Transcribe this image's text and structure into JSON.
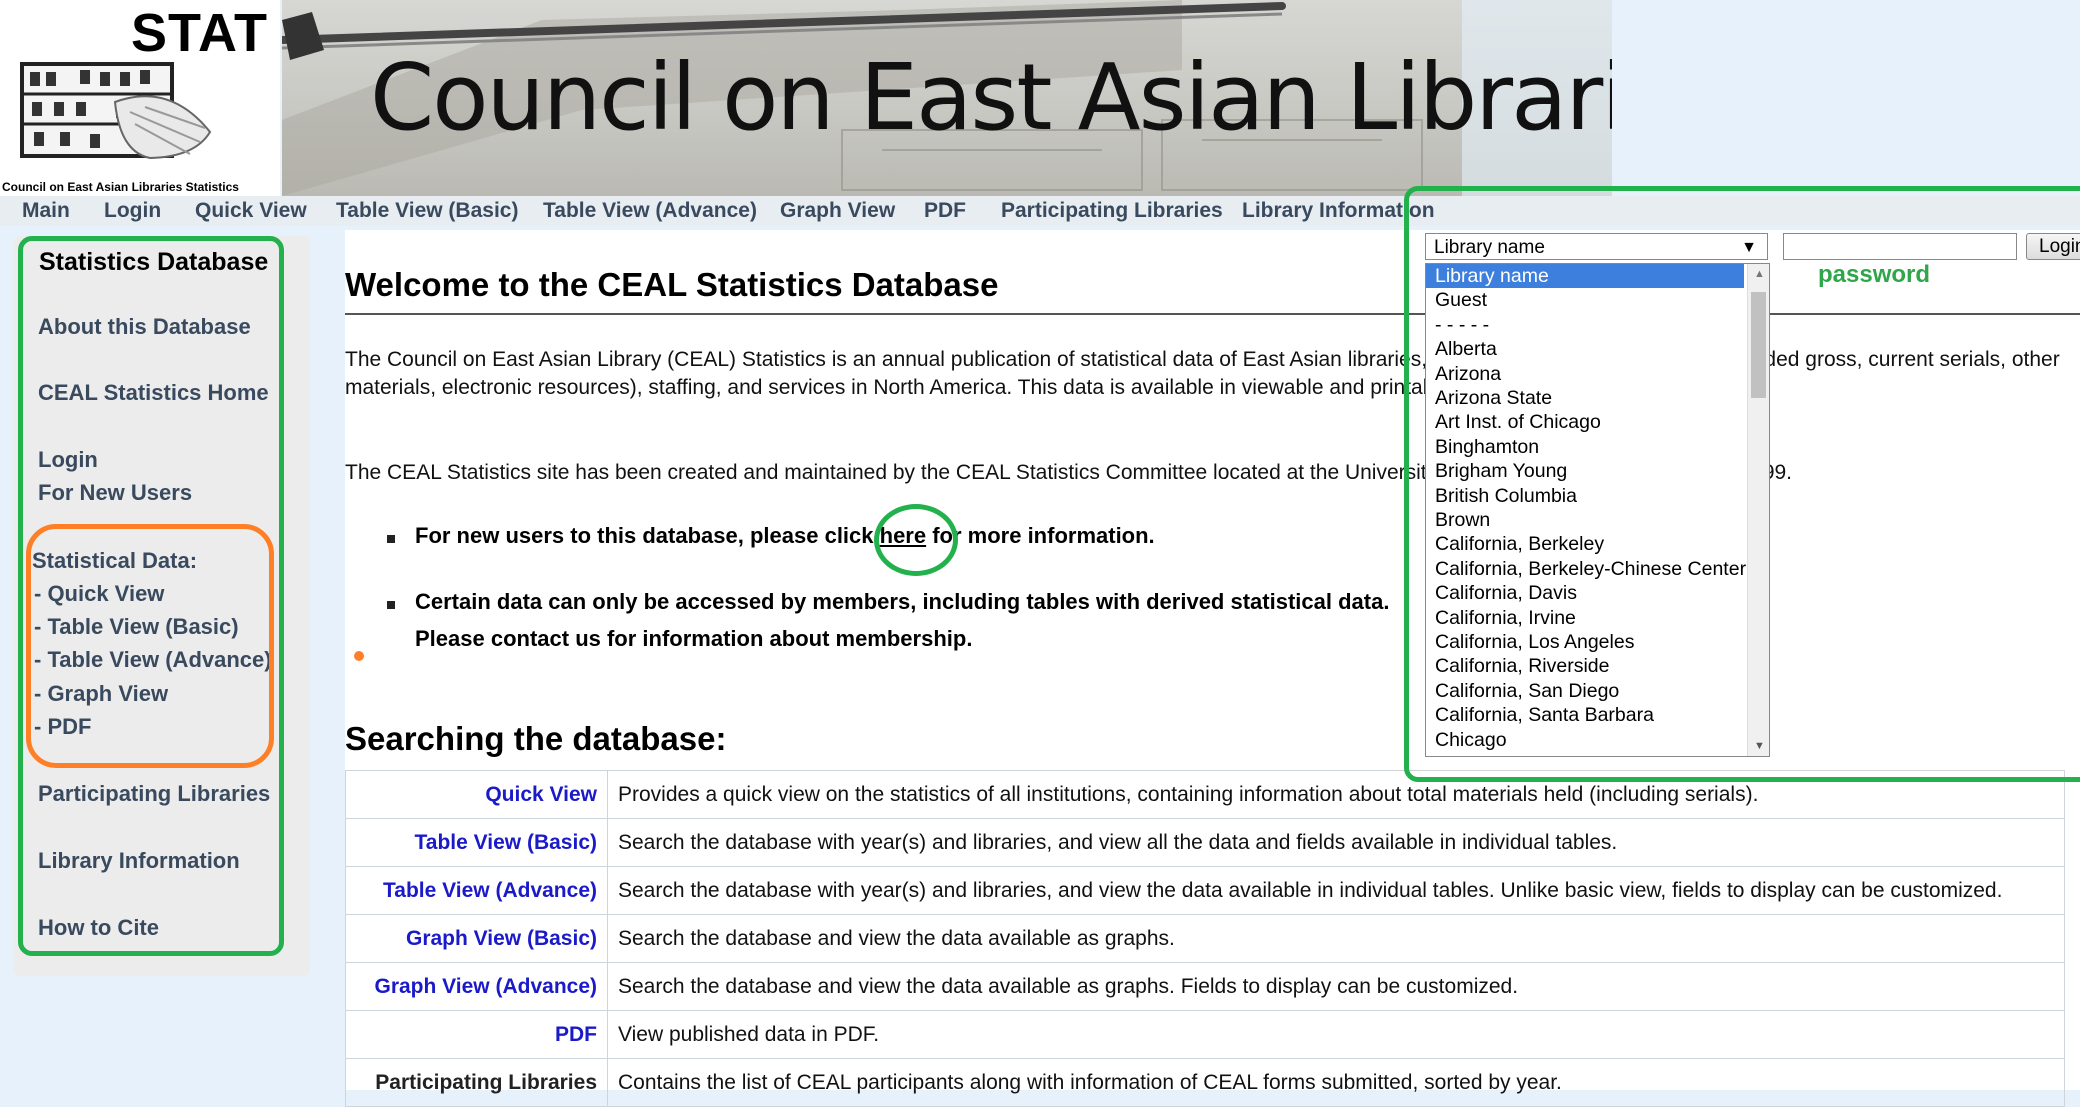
{
  "banner": {
    "logo_text": "STAT",
    "logo_caption": "Council on East Asian Libraries Statistics",
    "title": "Council on East Asian Libraries Statistics"
  },
  "topnav": [
    "Main",
    "Login",
    "Quick View",
    "Table View (Basic)",
    "Table View (Advance)",
    "Graph View",
    "PDF",
    "Participating Libraries",
    "Library Information"
  ],
  "sidebar": {
    "title": "Statistics Database",
    "links": [
      "About this Database",
      "CEAL Statistics Home",
      "Login",
      "For New Users"
    ],
    "section_label": "Statistical Data:",
    "section_items": [
      "-  Quick View",
      "-  Table View (Basic)",
      "-  Table View (Advance)",
      "-  Graph View",
      "-  PDF"
    ],
    "bottom_links": [
      "Participating Libraries",
      "Library Information",
      "How to Cite"
    ]
  },
  "main": {
    "title": "Welcome to the CEAL Statistics Database",
    "para1": "The Council on East Asian Library (CEAL) Statistics is an annual publication of statistical data of East Asian libraries, including volumes held, volumes added gross, current serials, other materials, electronic resources), staffing, and services in North America. This data is available in viewable and printable in tables and graph formats.",
    "para2": "The CEAL Statistics site has been created and maintained by the CEAL Statistics Committee located at the University of Kansas, Lawrence, KS since 1999.",
    "bullet1_pre": "For new users to this database, please click ",
    "bullet1_link": "here",
    "bullet1_post": " for more information.",
    "bullet2_line1": "Certain data can only be accessed by members, including tables with derived statistical data.",
    "bullet2_line2": "Please contact us for information about membership.",
    "search_title": "Searching the database:",
    "features": [
      {
        "name": "Quick View",
        "desc": "Provides a quick view on the statistics of all institutions, containing information about total materials held (including serials)."
      },
      {
        "name": "Table View (Basic)",
        "desc": "Search the database with year(s) and libraries, and view all the data and fields available in individual tables."
      },
      {
        "name": "Table View (Advance)",
        "desc": "Search the database with year(s) and libraries, and view the data available in individual tables. Unlike basic view, fields to display can be customized."
      },
      {
        "name": "Graph View (Basic)",
        "desc": "Search the database and view the data available as graphs."
      },
      {
        "name": "Graph View (Advance)",
        "desc": "Search the database and view the data available as graphs. Fields to display can be customized."
      },
      {
        "name": "PDF",
        "desc": "View published data in PDF."
      },
      {
        "name": "Participating Libraries",
        "desc": "Contains the list of CEAL participants along with information of CEAL forms submitted, sorted by year."
      }
    ]
  },
  "login": {
    "selected": "Library name",
    "password_label": "password",
    "button_label": "Login",
    "options": [
      "Library name",
      "Guest",
      "- - - - -",
      "Alberta",
      "Arizona",
      "Arizona State",
      "Art Inst. of Chicago",
      "Binghamton",
      "Brigham Young",
      "British Columbia",
      "Brown",
      "California, Berkeley",
      "California, Berkeley-Chinese Center",
      "California, Davis",
      "California, Irvine",
      "California, Los Angeles",
      "California, Riverside",
      "California, San Diego",
      "California, Santa Barbara",
      "Chicago"
    ]
  },
  "colors": {
    "annotation_green": "#22b14c",
    "annotation_orange": "#ff7f27",
    "link_blue": "#1a1ac8",
    "selected_blue": "#3d7fdc",
    "nav_text": "#3a4a5e"
  }
}
